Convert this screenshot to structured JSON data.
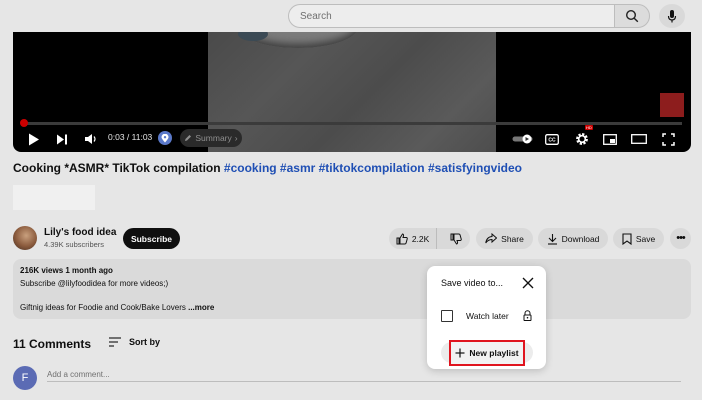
{
  "search": {
    "placeholder": "Search"
  },
  "icons": {
    "search": "search-icon",
    "mic": "mic-icon",
    "play": "play-icon",
    "next": "next-icon",
    "volume": "volume-icon",
    "captions": "captions-icon",
    "settings": "gear-icon",
    "miniplayer": "miniplayer-icon",
    "theater": "theater-icon",
    "fullscreen": "fullscreen-icon",
    "like": "thumb-up-icon",
    "dislike": "thumb-down-icon",
    "share": "share-icon",
    "download": "download-icon",
    "save": "bookmark-icon",
    "more": "more-horizontal-icon",
    "sort": "sort-icon",
    "close": "close-icon",
    "lock": "lock-icon",
    "plus": "plus-icon"
  },
  "player": {
    "time": "0:03 / 11:03",
    "chapter_label": "Summary",
    "hd_badge": "HD",
    "progress_fraction": 0.005
  },
  "video": {
    "title_plain": "Cooking *ASMR* TikTok compilation",
    "title_tags": "#cooking #asmr #tiktokcompilation #satisfyingvideo"
  },
  "channel": {
    "name": "Lily's food idea",
    "subscribers": "4.39K subscribers",
    "subscribe_label": "Subscribe"
  },
  "actions": {
    "like_count": "2.2K",
    "share_label": "Share",
    "download_label": "Download",
    "save_label": "Save"
  },
  "description": {
    "meta": "216K views  1 month ago",
    "line1": "Subscribe  @lilyfoodidea  for more videos;)",
    "line2": "Giftnig ideas for Foodie and Cook/Bake Lovers",
    "more_label": "...more"
  },
  "comments": {
    "count_label": "11 Comments",
    "sort_label": "Sort by",
    "avatar_initial": "F",
    "input_placeholder": "Add a comment..."
  },
  "save_dialog": {
    "title": "Save video to...",
    "watch_later_label": "Watch later",
    "new_playlist_label": "New playlist",
    "highlight_color": "#e0141e"
  }
}
